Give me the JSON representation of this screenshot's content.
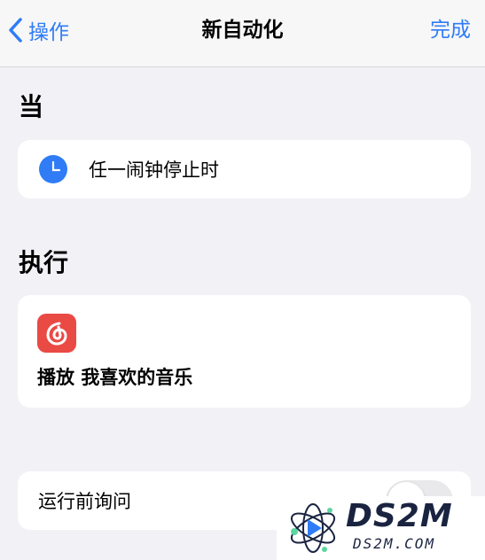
{
  "nav": {
    "back_label": "操作",
    "title": "新自动化",
    "done_label": "完成"
  },
  "trigger_section": {
    "header": "当",
    "item_label": "任一闹钟停止时",
    "icon": "clock-icon"
  },
  "action_section": {
    "header": "执行",
    "app_icon": "netease-music-icon",
    "verb": "播放",
    "object": "我喜欢的音乐"
  },
  "ask_before_running": {
    "label": "运行前询问",
    "enabled": false
  },
  "watermark": {
    "title": "DS2M",
    "subtitle": "DS2M.COM"
  },
  "colors": {
    "accent": "#2f7cf6",
    "background": "#f2f2f6",
    "card": "#ffffff",
    "app_icon": "#ea4a44",
    "toggle_off": "#e9e9eb"
  }
}
